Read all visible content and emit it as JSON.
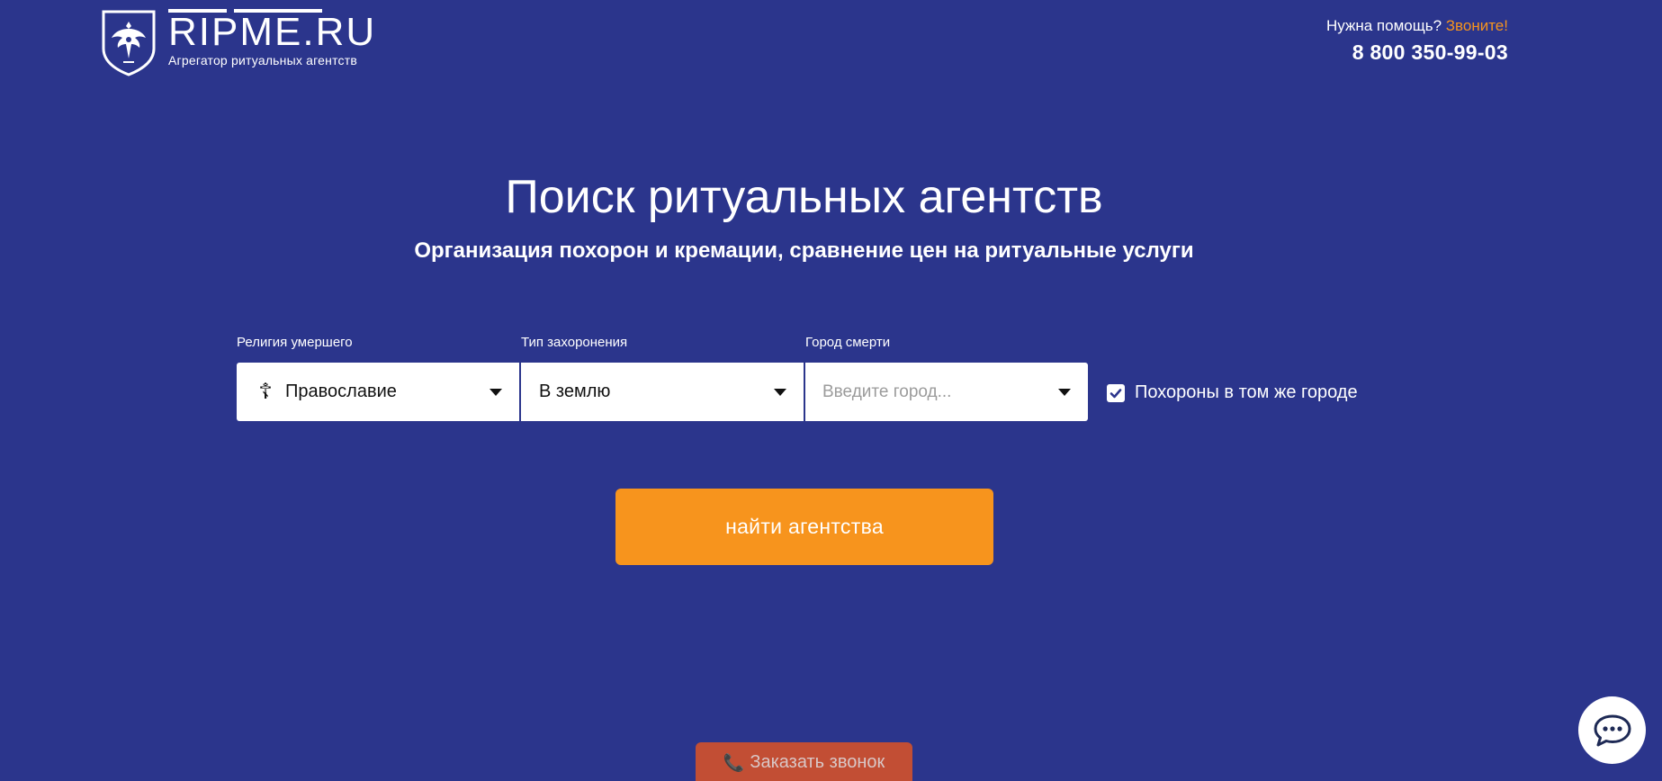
{
  "header": {
    "logo_name": "RIPME.RU",
    "logo_tagline": "Агрегатор ритуальных агентств",
    "help_text": "Нужна помощь?",
    "help_call": "Звоните!",
    "phone": "8 800 350-99-03"
  },
  "hero": {
    "title": "Поиск ритуальных агентств",
    "subtitle": "Организация похорон и кремации, сравнение цен на ритуальные услуги"
  },
  "search": {
    "religion_label": "Религия умершего",
    "religion_value": "Православие",
    "religion_icon": "orthodox-cross-icon",
    "burial_label": "Тип захоронения",
    "burial_value": "В землю",
    "city_label": "Город смерти",
    "city_placeholder": "Введите город...",
    "same_city_label": "Похороны в том же городе",
    "same_city_checked": true,
    "submit_label": "найти агентства"
  },
  "footer_widgets": {
    "callback_label": "Заказать звонок",
    "chat_icon": "chat-bubble-icon"
  },
  "colors": {
    "background": "#2b358c",
    "accent": "#f7941d",
    "callback": "#c24e34"
  }
}
